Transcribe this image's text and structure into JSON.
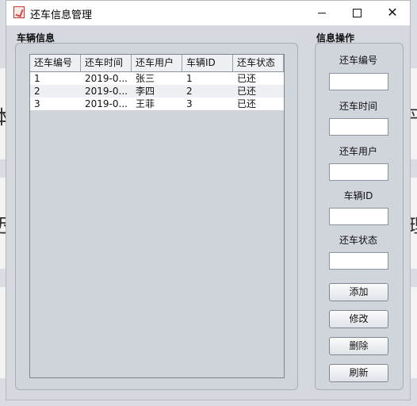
{
  "window": {
    "title": "还车信息管理"
  },
  "background": {
    "glyph_left_1": "本",
    "glyph_left_2": "迟",
    "glyph_right_1": "平",
    "glyph_right_2": "理"
  },
  "left_panel": {
    "title": "车辆信息",
    "table": {
      "columns": [
        "还车编号",
        "还车时间",
        "还车用户",
        "车辆ID",
        "还车状态"
      ],
      "rows": [
        [
          "1",
          "2019-0...",
          "张三",
          "1",
          "已还"
        ],
        [
          "2",
          "2019-0...",
          "李四",
          "2",
          "已还"
        ],
        [
          "3",
          "2019-0...",
          "王菲",
          "3",
          "已还"
        ]
      ]
    }
  },
  "right_panel": {
    "title": "信息操作",
    "fields": [
      {
        "label": "还车编号",
        "value": ""
      },
      {
        "label": "还车时间",
        "value": ""
      },
      {
        "label": "还车用户",
        "value": ""
      },
      {
        "label": "车辆ID",
        "value": ""
      },
      {
        "label": "还车状态",
        "value": ""
      }
    ],
    "buttons": {
      "add": "添加",
      "modify": "修改",
      "delete": "删除",
      "refresh": "刷新"
    }
  },
  "icons": {
    "app": "java-cup-icon",
    "minimize": "minimize-icon",
    "maximize": "maximize-icon",
    "close": "close-icon"
  }
}
